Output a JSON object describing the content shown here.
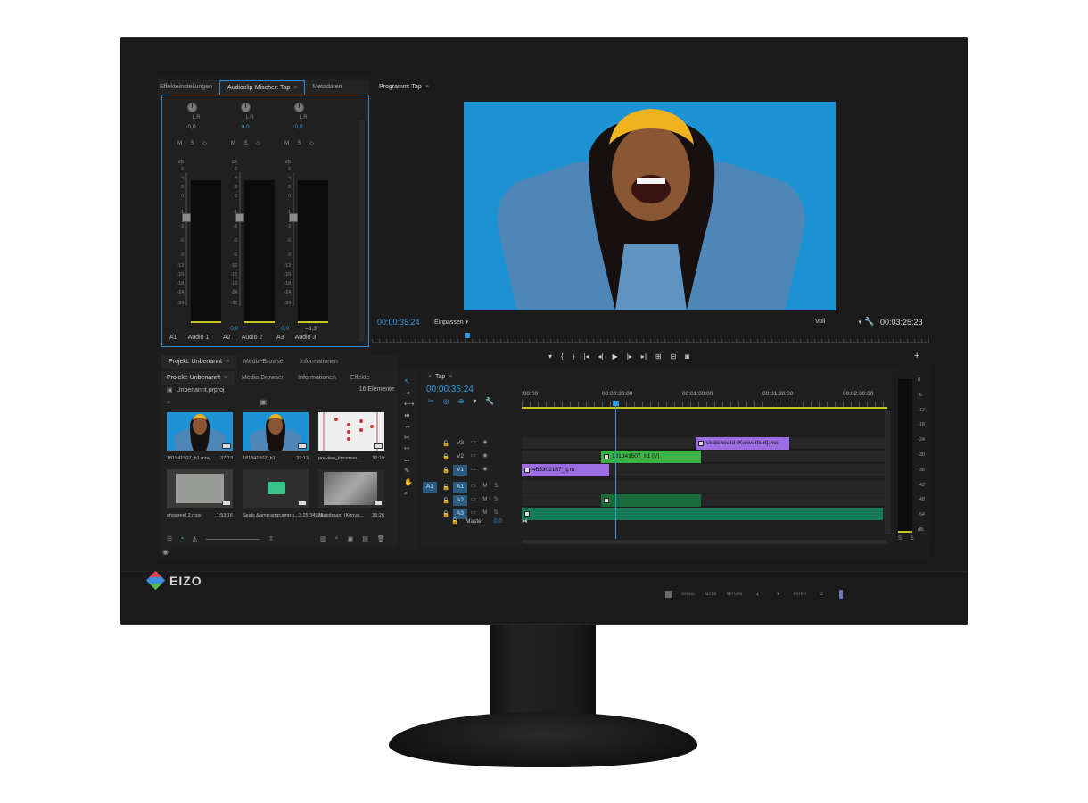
{
  "mixer": {
    "tabs": [
      {
        "label": "Effekteinstellungen",
        "active": false
      },
      {
        "label": "Audioclip-Mischer: Tap",
        "active": true
      },
      {
        "label": "Metadaten",
        "active": false
      }
    ],
    "channels": [
      {
        "pan_label": "L R",
        "pan_value": "0,0",
        "msr": "M S ◇",
        "meter_value": "",
        "fader_value": "",
        "track": "A1",
        "name": "Audio 1"
      },
      {
        "pan_label": "L R",
        "pan_value": "0,0",
        "msr": "M S ◇",
        "meter_value": "0,0",
        "fader_value": "",
        "track": "A2",
        "name": "Audio 2"
      },
      {
        "pan_label": "L R",
        "pan_value": "0,0",
        "msr": "M S ◇",
        "meter_value": "0,0",
        "fader_value": "–3,3",
        "track": "A3",
        "name": "Audio 3"
      }
    ],
    "db_scale": [
      "dB",
      "6",
      "4",
      "2",
      "0",
      "-1",
      "-3",
      "-6",
      "-9",
      "-12",
      "-15",
      "-18",
      "-24",
      "-33"
    ]
  },
  "program": {
    "title": "Programm: Tap",
    "timecode_left": "00:00:35:24",
    "fit": "Einpassen",
    "quality": "Voll",
    "timecode_right": "00:03:25:23",
    "transport": [
      "▾",
      "{",
      "}",
      "|◂",
      "◂|",
      "▶",
      "|▸",
      "▸|",
      "⊞",
      "⊟",
      "◙"
    ]
  },
  "project": {
    "top_tabs": [
      {
        "label": "Projekt: Unbenannt",
        "active": true
      },
      {
        "label": "Media-Browser",
        "active": false
      },
      {
        "label": "Informationen",
        "active": false
      }
    ],
    "tabs": [
      {
        "label": "Projekt: Unbenannt",
        "active": true
      },
      {
        "label": "Media-Browser",
        "active": false
      },
      {
        "label": "Informationen",
        "active": false
      },
      {
        "label": "Effekte",
        "active": false
      }
    ],
    "file": "Unbenannt.prproj",
    "count": "16 Elemente",
    "items": [
      {
        "name": "181841507_h1.mov",
        "dur": "37:13",
        "kind": "portrait"
      },
      {
        "name": "181841507_h1",
        "dur": "37:13",
        "kind": "portrait"
      },
      {
        "name": "preview_timomaa...",
        "dur": "32:19",
        "kind": "pattern"
      },
      {
        "name": "showreel 2.mov",
        "dur": "1:53:16",
        "kind": "gray"
      },
      {
        "name": "Seals &amp;amp;amp;s...",
        "dur": "3:25:34928",
        "kind": "audio"
      },
      {
        "name": "skateboard (Konve...",
        "dur": "35:26",
        "kind": "bw"
      }
    ]
  },
  "timeline": {
    "tab": "Tap",
    "timecode": "00:00:35:24",
    "ruler": [
      ":00:00",
      "00:00:30:00",
      "00:01:00:00",
      "00:01:30:00",
      "00:02:00:00"
    ],
    "tracks": [
      {
        "name": "V3",
        "kind": "video"
      },
      {
        "name": "V2",
        "kind": "video"
      },
      {
        "name": "V1",
        "kind": "video"
      },
      {
        "name": "A1",
        "kind": "audio",
        "source": "A1"
      },
      {
        "name": "A2",
        "kind": "audio"
      },
      {
        "name": "A3",
        "kind": "audio"
      }
    ],
    "master_label": "Master",
    "master_value": "0,0",
    "clips": [
      {
        "label": "skateboard (Konvertiert).mo",
        "track": 0
      },
      {
        "label": "181841507_h1 [V]",
        "track": 1
      },
      {
        "label": "465302167_q.m",
        "track": 2
      }
    ]
  },
  "meter_right": {
    "scale": [
      "0",
      "-6",
      "-12",
      "-18",
      "-24",
      "-30",
      "-36",
      "-42",
      "-48",
      "-54",
      "dB"
    ],
    "solo": "S S"
  },
  "hardware": {
    "brand": "EIZO",
    "buttons": [
      "SIGNAL",
      "MODE",
      "RETURN",
      "▲",
      "▼",
      "ENTER",
      "⏻"
    ]
  }
}
